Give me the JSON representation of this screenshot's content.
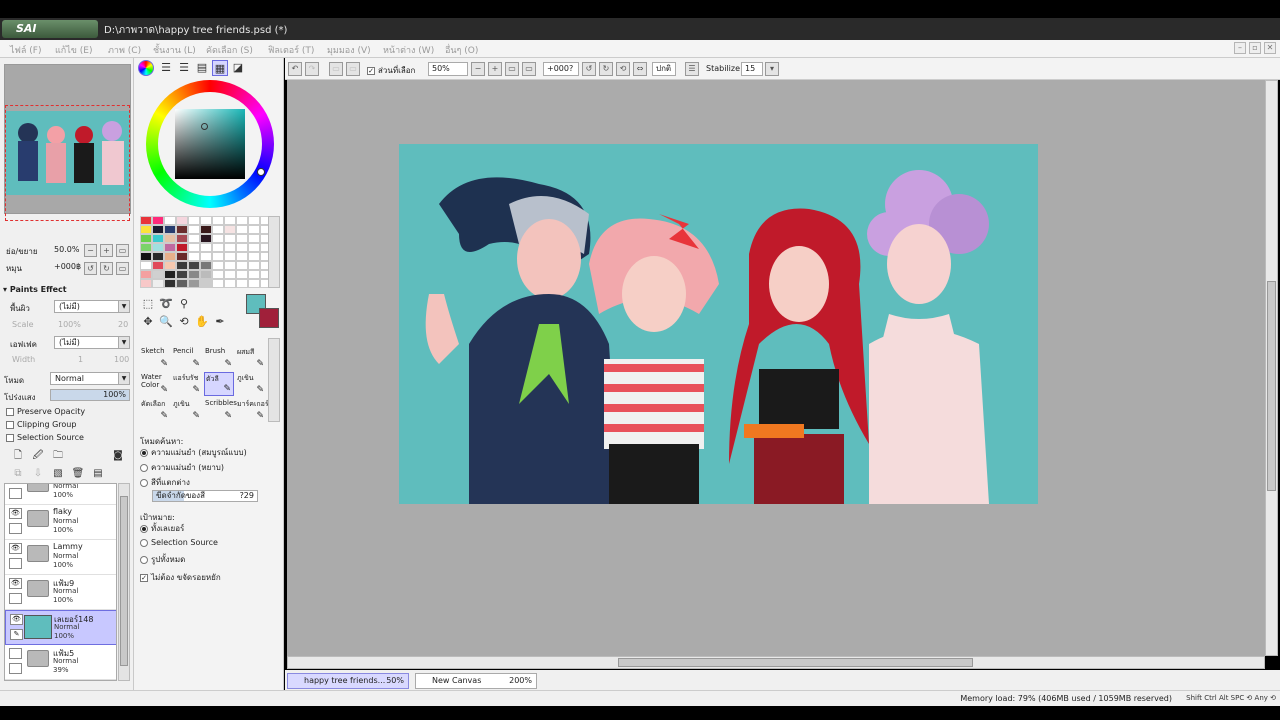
{
  "app": {
    "name": "SAI",
    "title": "D:\\ภาพวาด\\happy tree friends.psd (*)"
  },
  "menu": [
    "ไฟล์ (F)",
    "แก้ไข (E)",
    "ภาพ (C)",
    "ชั้นงาน (L)",
    "คัดเลือก (S)",
    "ฟิลเตอร์ (T)",
    "มุมมอง (V)",
    "หน้าต่าง (W)",
    "อื่นๆ (O)"
  ],
  "navigator": {
    "zoom_label": "ย่อ/ขยาย",
    "zoom": "50.0%",
    "rotate_label": "หมุน",
    "rotate": "+000฿"
  },
  "paint_effects": {
    "header": "Paints Effect",
    "texture_label": "พื้นผิว",
    "texture_value": "(ไม่มี)",
    "scale_label": "Scale",
    "scale_value": "100%",
    "scale_num": "20",
    "effect_label": "เอฟเฟค",
    "effect_value": "(ไม่มี)",
    "width_label": "Width",
    "width_num1": "1",
    "width_num2": "100"
  },
  "blend": {
    "mode_label": "โหมด",
    "mode_value": "Normal",
    "opacity_label": "โปร่งแสง",
    "opacity_value": "100%",
    "opacity_fraction": 1.0
  },
  "checkboxes": [
    "Preserve Opacity",
    "Clipping Group",
    "Selection Source"
  ],
  "layers": [
    {
      "name": "",
      "mode": "Normal",
      "opacity": "100%",
      "visible": false,
      "folder": true
    },
    {
      "name": "flaky",
      "mode": "Normal",
      "opacity": "100%",
      "visible": true,
      "folder": true
    },
    {
      "name": "Lammy",
      "mode": "Normal",
      "opacity": "100%",
      "visible": true,
      "folder": true
    },
    {
      "name": "แฟ้ม9",
      "mode": "Normal",
      "opacity": "100%",
      "visible": true,
      "folder": true
    },
    {
      "name": "เลเยอร์148",
      "mode": "Normal",
      "opacity": "100%",
      "visible": true,
      "folder": false,
      "selected": true
    },
    {
      "name": "แฟ้ม5",
      "mode": "Normal",
      "opacity": "39%",
      "visible": false,
      "folder": true
    }
  ],
  "brushes": [
    "Sketch",
    "Pencil",
    "Brush",
    "ผสมสี",
    "Water Color",
    "แอร์บรัช",
    "ตัวลี",
    "ภูเขิน",
    "คัดเลือก",
    "ภูเขิน",
    "Scribbles",
    "มาร์คเกอร์"
  ],
  "fill_options": {
    "mode_label": "โหมดค้นหา:",
    "radio1": "ความแม่นยำ (สมบูรณ์แบบ)",
    "radio2": "ความแม่นยำ (หยาบ)",
    "radio3": "สีที่แตกต่าง",
    "tolerance_label": "ขีดจำกัดของสี",
    "tolerance_value": "?29",
    "target_label": "เป้าหมาย:",
    "t1": "ทั้งเลเยอร์",
    "t2": "Selection Source",
    "t3": "รูปทั้งหมด",
    "antialias": "ไม่ต้อง ขจัดรอยหยัก"
  },
  "toolbar": {
    "selection_check": "ส่วนที่เลือก",
    "zoom": "50%",
    "rotation": "+000?",
    "mode": "ปกติ",
    "stabilize_label": "Stabilize",
    "stabilize_value": "15"
  },
  "doc_tabs": [
    {
      "name": "happy tree friends...",
      "zoom": "50%",
      "active": true
    },
    {
      "name": "New Canvas",
      "zoom": "200%",
      "active": false
    }
  ],
  "status": {
    "memory": "Memory load: 79% (406MB used / 1059MB reserved)",
    "keys": "Shift Ctrl Alt SPC ⟲ Any ⟲"
  },
  "colors": {
    "canvas_bg": "#5fbdbd",
    "accent": "#8a8ae0",
    "primary_color": "#5fbdbd",
    "secondary_color": "#a0203a"
  },
  "palette": [
    "#e8343a",
    "#ff2a7a",
    "#fff",
    "#f5d6de",
    "#fff",
    "#fff",
    "#fff",
    "#fff",
    "#fff",
    "#fff",
    "#fff",
    "#fbe33a",
    "#1a1a2e",
    "#283c6e",
    "#6a2e2e",
    "#fff",
    "#3a1a1a",
    "#fff",
    "#f6e3e3",
    "#fff",
    "#fff",
    "#fff",
    "#6ad04a",
    "#3acacf",
    "#e6c0a6",
    "#a84a54",
    "#fff",
    "#2a1620",
    "#fff",
    "#fff",
    "#fff",
    "#fff",
    "#fff",
    "#7bd36a",
    "#a0e0e0",
    "#c06aa0",
    "#c01a2a",
    "#fff",
    "#fff",
    "#fff",
    "#fff",
    "#fff",
    "#fff",
    "#fff",
    "#111",
    "#2a2a2a",
    "#e8b08a",
    "#6a2a2a",
    "#fff",
    "#fff",
    "#fff",
    "#fff",
    "#fff",
    "#fff",
    "#fff",
    "#fff",
    "#e04a5a",
    "#f6c9b0",
    "#3a3a3a",
    "#444",
    "#777",
    "#fff",
    "#fff",
    "#fff",
    "#fff",
    "#fff",
    "#f3a0a0",
    "#d0d0d0",
    "#202020",
    "#404040",
    "#888",
    "#bbb",
    "#fff",
    "#fff",
    "#fff",
    "#fff",
    "#fff",
    "#f8c8c8",
    "#eee",
    "#303030",
    "#606060",
    "#999",
    "#ccc",
    "#fff",
    "#fff",
    "#fff",
    "#fff",
    "#fff"
  ]
}
